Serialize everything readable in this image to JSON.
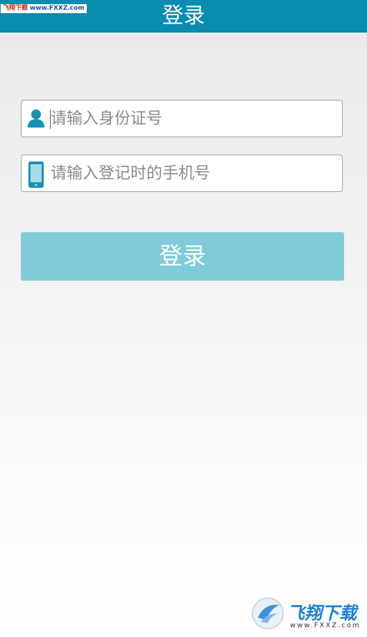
{
  "header": {
    "title": "登录"
  },
  "watermark_top": {
    "part1": "飞翔下载",
    "part2": "www.FXXZ.com"
  },
  "form": {
    "id_field": {
      "icon": "user-icon",
      "placeholder": "请输入身份证号",
      "value": ""
    },
    "phone_field": {
      "icon": "phone-icon",
      "placeholder": "请输入登记时的手机号",
      "value": ""
    },
    "submit_label": "登录"
  },
  "watermark_bottom": {
    "text": "飞翔下载",
    "url": "www.FXXZ.com"
  },
  "colors": {
    "header": "#0a8bb0",
    "icon": "#1592b3",
    "button": "#80cbd9",
    "button_text": "#ffffff"
  }
}
